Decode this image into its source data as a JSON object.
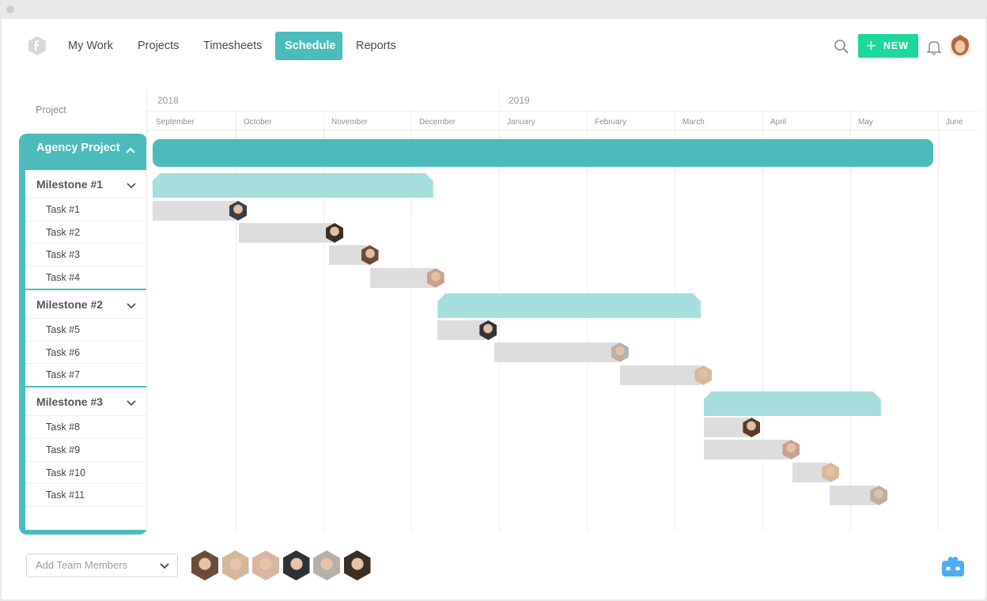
{
  "app": {
    "logo_icon": "hexagon-logo-icon"
  },
  "nav": {
    "items": [
      {
        "label": "My Work",
        "active": false
      },
      {
        "label": "Projects",
        "active": false
      },
      {
        "label": "Timesheets",
        "active": false
      },
      {
        "label": "Schedule",
        "active": true
      },
      {
        "label": "Reports",
        "active": false
      }
    ],
    "new_button_label": "NEW",
    "icons": [
      "search-icon",
      "plus-icon",
      "bell-icon",
      "user-avatar"
    ]
  },
  "schedule": {
    "project_column_header": "Project",
    "project": {
      "name": "Agency Project",
      "expanded": true
    },
    "milestones": [
      {
        "name": "Milestone #1",
        "tasks": [
          "Task #1",
          "Task #2",
          "Task #3",
          "Task #4"
        ]
      },
      {
        "name": "Milestone #2",
        "tasks": [
          "Task #5",
          "Task #6",
          "Task #7"
        ]
      },
      {
        "name": "Milestone #3",
        "tasks": [
          "Task #8",
          "Task #9",
          "Task #10",
          "Task #11"
        ]
      }
    ]
  },
  "timeline": {
    "years": [
      {
        "label": "2018",
        "start_month_index": 0
      },
      {
        "label": "2019",
        "start_month_index": 4
      }
    ],
    "months": [
      "September",
      "October",
      "November",
      "December",
      "January",
      "February",
      "March",
      "April",
      "May",
      "June"
    ]
  },
  "chart_data": {
    "type": "gantt",
    "unit": "months since start of September 2018",
    "project_bar": {
      "name": "Agency Project",
      "start": 0.05,
      "end": 8.95
    },
    "milestone_bars": [
      {
        "name": "Milestone #1",
        "start": 0.05,
        "end": 3.25
      },
      {
        "name": "Milestone #2",
        "start": 3.3,
        "end": 6.3
      },
      {
        "name": "Milestone #3",
        "start": 6.33,
        "end": 8.35
      }
    ],
    "task_bars": [
      {
        "name": "Task #1",
        "start": 0.05,
        "end": 1.0,
        "assignee_color": "#3a3f47"
      },
      {
        "name": "Task #2",
        "start": 1.04,
        "end": 2.1,
        "assignee_color": "#3b2e24"
      },
      {
        "name": "Task #3",
        "start": 2.06,
        "end": 2.5,
        "assignee_color": "#6d4a3a"
      },
      {
        "name": "Task #4",
        "start": 2.53,
        "end": 3.25,
        "assignee_color": "#c9a08c"
      },
      {
        "name": "Task #5",
        "start": 3.3,
        "end": 3.85,
        "assignee_color": "#2f333a"
      },
      {
        "name": "Task #6",
        "start": 3.95,
        "end": 5.35,
        "assignee_color": "#b9b0a6"
      },
      {
        "name": "Task #7",
        "start": 5.38,
        "end": 6.3,
        "assignee_color": "#d9b89a"
      },
      {
        "name": "Task #8",
        "start": 6.33,
        "end": 6.85,
        "assignee_color": "#5b3b2e"
      },
      {
        "name": "Task #9",
        "start": 6.33,
        "end": 7.3,
        "assignee_color": "#caa18c"
      },
      {
        "name": "Task #10",
        "start": 7.34,
        "end": 7.75,
        "assignee_color": "#d9b89a"
      },
      {
        "name": "Task #11",
        "start": 7.77,
        "end": 8.3,
        "assignee_color": "#b9b0a6"
      }
    ]
  },
  "footer": {
    "add_members_placeholder": "Add Team Members",
    "team_members": [
      {
        "name": "team-member-1",
        "color": "#6b4b3c"
      },
      {
        "name": "team-member-2",
        "color": "#d2b89c"
      },
      {
        "name": "team-member-3",
        "color": "#d8b6a4"
      },
      {
        "name": "team-member-4",
        "color": "#2e3238"
      },
      {
        "name": "team-member-5",
        "color": "#b7b0a8"
      },
      {
        "name": "team-member-6",
        "color": "#3b2e24"
      }
    ],
    "bot_icon": "robot-icon"
  },
  "colors": {
    "accent": "#4bbcbb",
    "milestone": "#a5dedc",
    "task": "#dddddd",
    "new_button": "#1dd79b",
    "bot": "#4aaef0"
  }
}
